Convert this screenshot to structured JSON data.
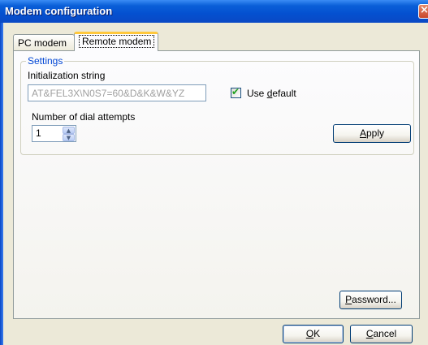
{
  "window": {
    "title": "Modem configuration",
    "close_glyph": "×"
  },
  "tabs": [
    {
      "label": "PC modem",
      "selected": false
    },
    {
      "label": "Remote modem",
      "selected": true
    }
  ],
  "settings": {
    "group_label": "Settings",
    "init_label": "Initialization string",
    "init_value": "AT&FEL3X\\N0S7=60&D&K&W&YZ",
    "use_default_label_pre": "Use ",
    "use_default_label_key": "d",
    "use_default_label_post": "efault",
    "use_default_checked": true,
    "check_glyph": "✔",
    "dial_label": "Number of dial attempts",
    "dial_value": "1",
    "spin_up_glyph": "▲",
    "spin_down_glyph": "▼",
    "apply_key": "A",
    "apply_rest": "pply"
  },
  "buttons": {
    "password_key": "P",
    "password_rest": "assword...",
    "ok_key": "O",
    "ok_rest": "K",
    "cancel_key": "C",
    "cancel_rest": "ancel"
  },
  "colors": {
    "titlebar": "#0450d0",
    "client": "#ece9d8",
    "accent": "#0046d5",
    "check": "#21a121",
    "tab_highlight": "#ffc83c"
  }
}
